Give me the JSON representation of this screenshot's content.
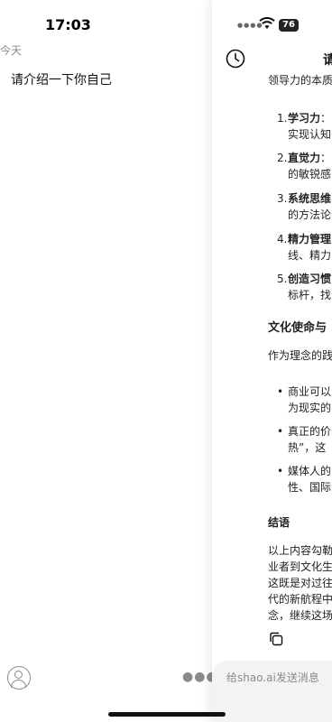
{
  "drawer": {
    "time": "17:03",
    "section": "今天",
    "history": [
      "请介绍一下你自己"
    ]
  },
  "status_bar": {
    "battery": "76"
  },
  "chat": {
    "title_fragment": "请",
    "intro": "领导力的本质",
    "list": [
      {
        "num": "1.",
        "title": "学习力",
        "line1_tail": "：",
        "line2": "实现认知"
      },
      {
        "num": "2.",
        "title": "直觉力",
        "line1_tail": "：",
        "line2": "的敏锐感"
      },
      {
        "num": "3.",
        "title": "系统思维",
        "line1_tail": "",
        "line2": "的方法论"
      },
      {
        "num": "4.",
        "title": "精力管理",
        "line1_tail": "",
        "line2": "线、精力"
      },
      {
        "num": "5.",
        "title": "创造习惯",
        "line1_tail": "",
        "line2": "标杆，找"
      }
    ],
    "section_heading": "文化使命与",
    "section_intro": "作为理念的践",
    "bullets": [
      {
        "line1": "商业可以",
        "line2": "为现实的"
      },
      {
        "line1": "真正的价",
        "line2": "热”，这"
      },
      {
        "line1": "媒体人的",
        "line2": "性、国际"
      }
    ],
    "conclusion_heading": "结语",
    "conclusion_lines": [
      "以上内容勾勒",
      "业者到文化生",
      "这既是对过往",
      "代的新航程中",
      "念，继续这场"
    ]
  },
  "input": {
    "placeholder": "给shao.ai发送消息"
  }
}
